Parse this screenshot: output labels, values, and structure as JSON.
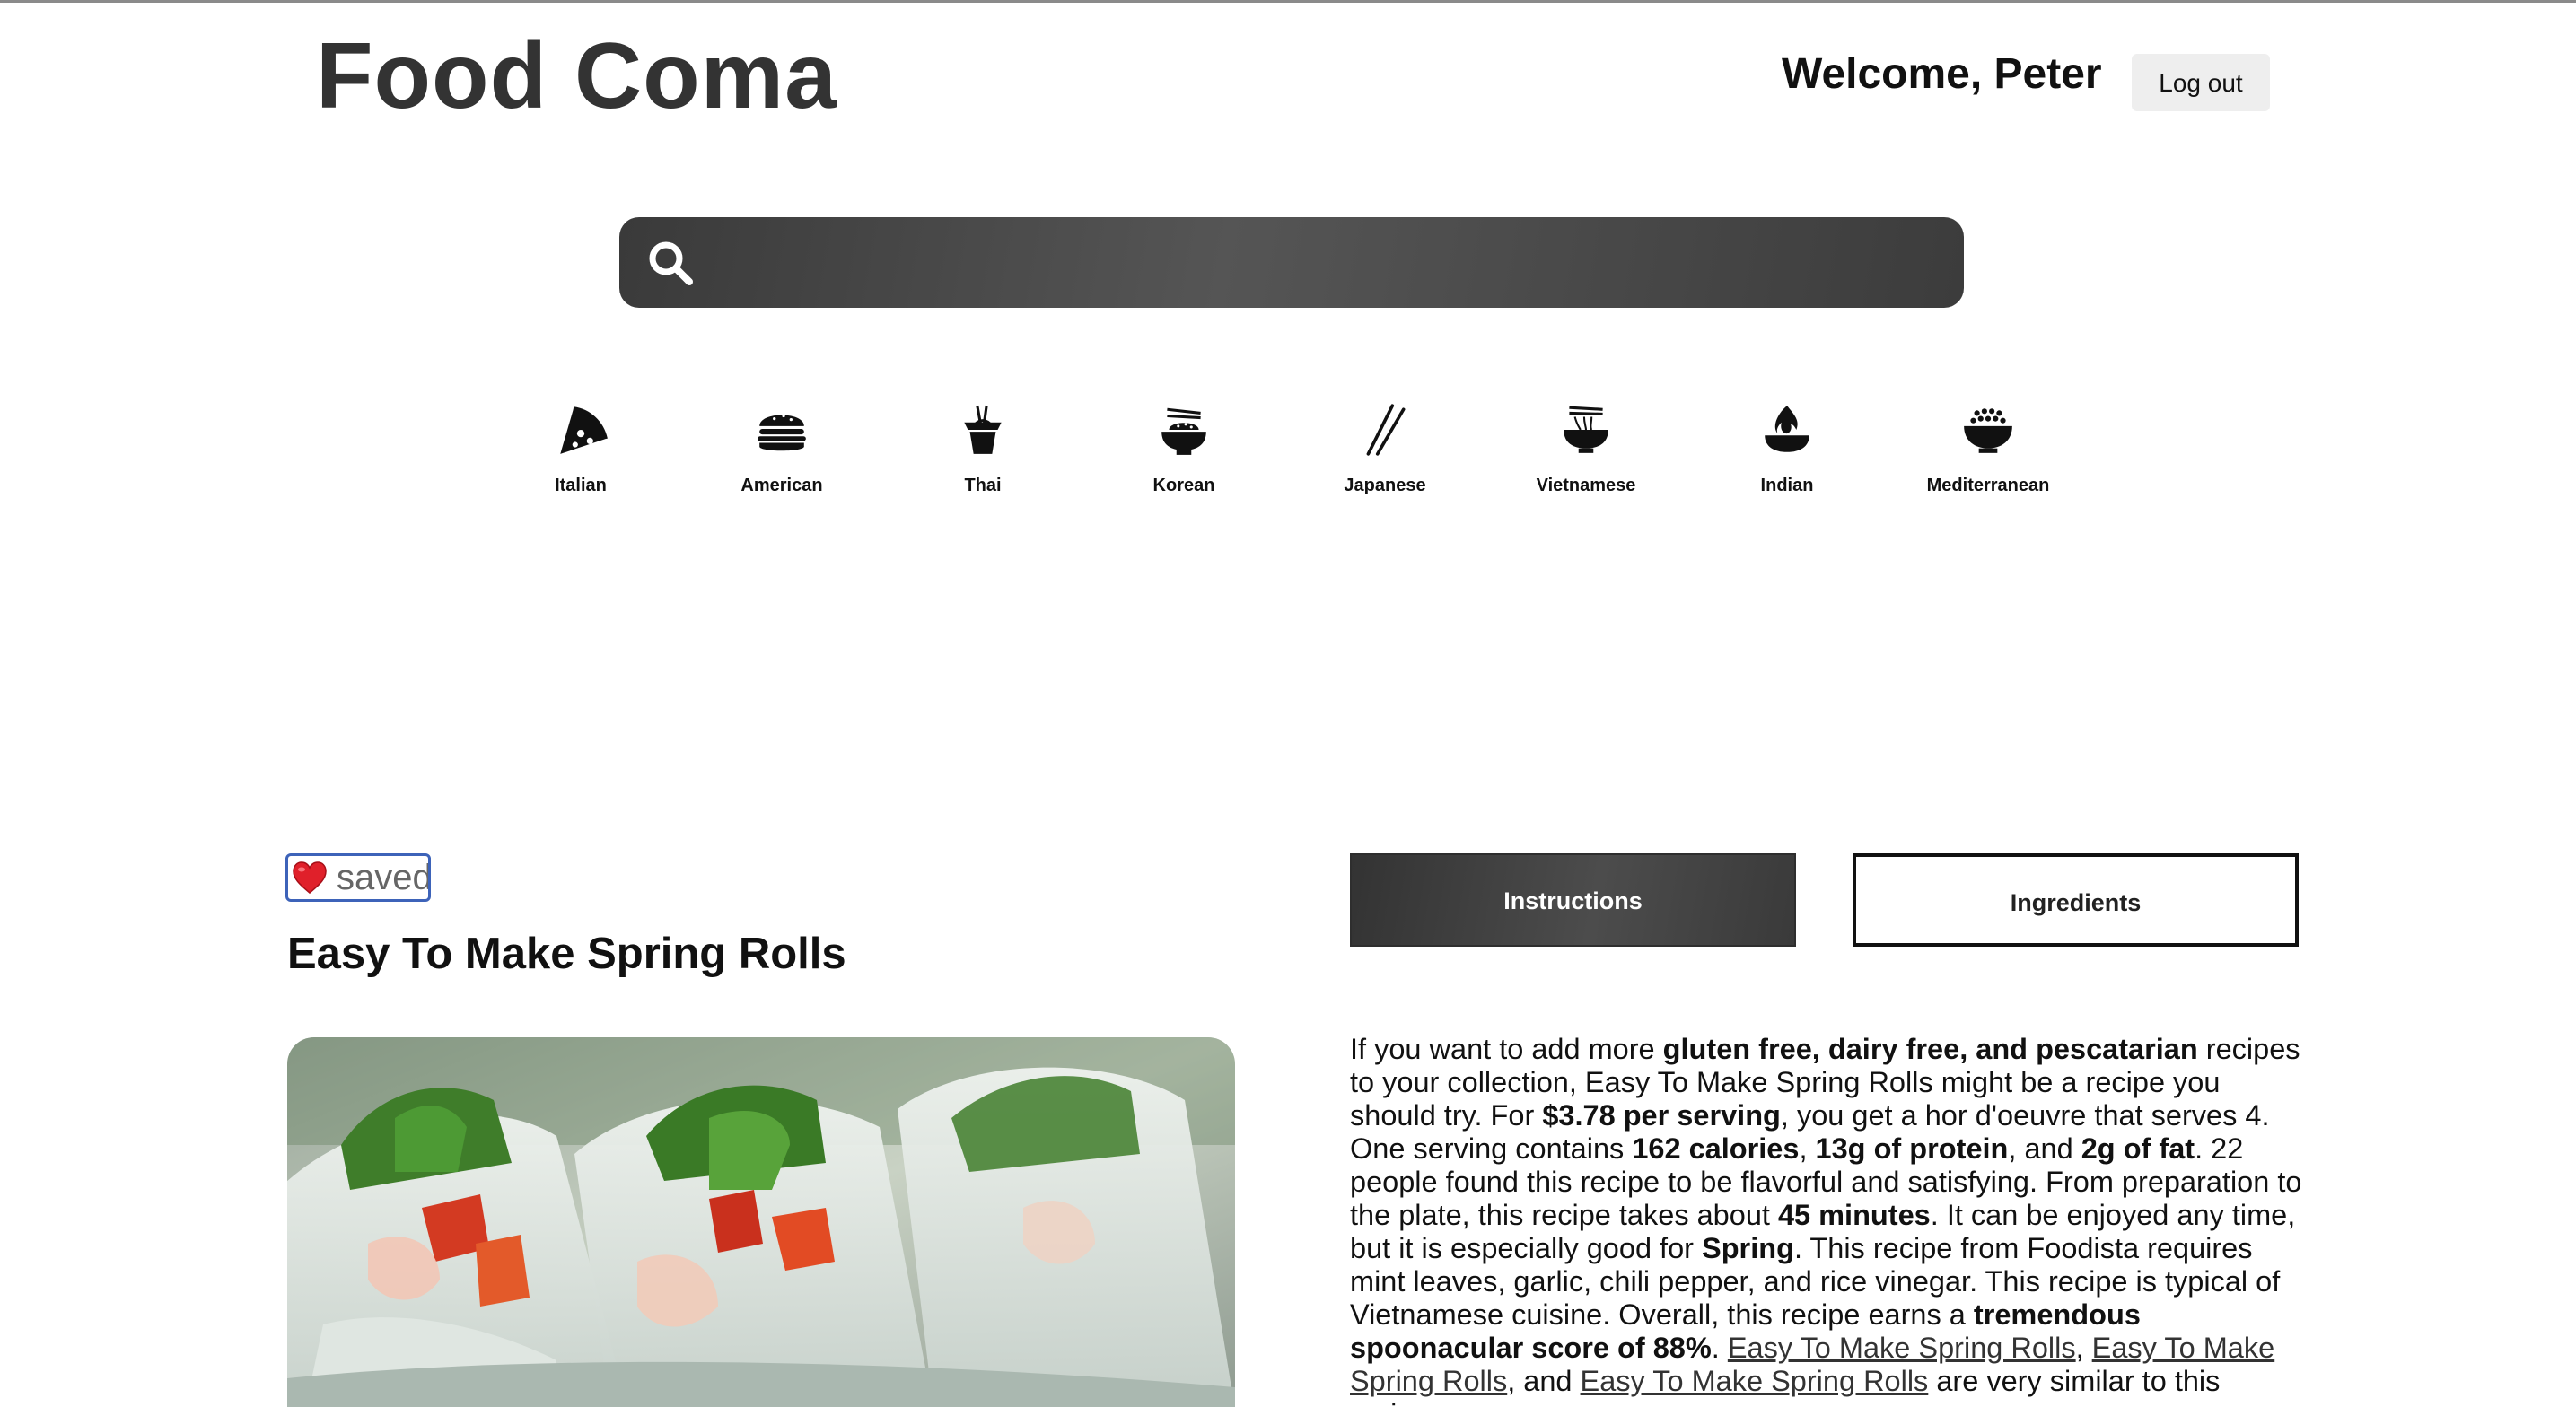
{
  "header": {
    "brand": "Food Coma",
    "welcome": "Welcome, Peter",
    "logout_label": "Log out"
  },
  "search": {
    "icon": "search-icon",
    "placeholder": "",
    "value": ""
  },
  "cuisines": [
    {
      "label": "Italian",
      "icon": "pizza-icon"
    },
    {
      "label": "American",
      "icon": "burger-icon"
    },
    {
      "label": "Thai",
      "icon": "takeout-box-icon"
    },
    {
      "label": "Korean",
      "icon": "rice-bowl-chopsticks-icon"
    },
    {
      "label": "Japanese",
      "icon": "chopsticks-icon"
    },
    {
      "label": "Vietnamese",
      "icon": "noodle-bowl-icon"
    },
    {
      "label": "Indian",
      "icon": "flame-bowl-icon"
    },
    {
      "label": "Mediterranean",
      "icon": "grain-bowl-icon"
    }
  ],
  "recipe": {
    "saved_label": "saved",
    "saved_icon": "heart-icon",
    "title": "Easy To Make Spring Rolls",
    "image_alt": "spring-rolls-photo"
  },
  "tabs": {
    "instructions": "Instructions",
    "ingredients": "Ingredients"
  },
  "summary": {
    "s1": "If you want to add more ",
    "b1": "gluten free, dairy free, and pescatarian",
    "s2": " recipes to your collection, Easy To Make Spring Rolls might be a recipe you should try. For ",
    "b2": "$3.78 per serving",
    "s3": ", you get a hor d'oeuvre that serves 4. One serving contains ",
    "b3": "162 calories",
    "s4": ", ",
    "b4": "13g of protein",
    "s5": ", and ",
    "b5": "2g of fat",
    "s6": ". 22 people found this recipe to be flavorful and satisfying. From preparation to the plate, this recipe takes about ",
    "b6": "45 minutes",
    "s7": ". It can be enjoyed any time, but it is especially good for ",
    "b7": "Spring",
    "s8": ". This recipe from Foodista requires mint leaves, garlic, chili pepper, and rice vinegar. This recipe is typical of Vietnamese cuisine. Overall, this recipe earns a ",
    "b8": "tremendous spoonacular score of 88%",
    "s9": ". ",
    "link1": "Easy To Make Spring Rolls",
    "s10": ", ",
    "link2": "Easy To Make Spring Rolls",
    "s11": ", and ",
    "link3": "Easy To Make Spring Rolls",
    "s12": " are very similar to this recipe."
  }
}
